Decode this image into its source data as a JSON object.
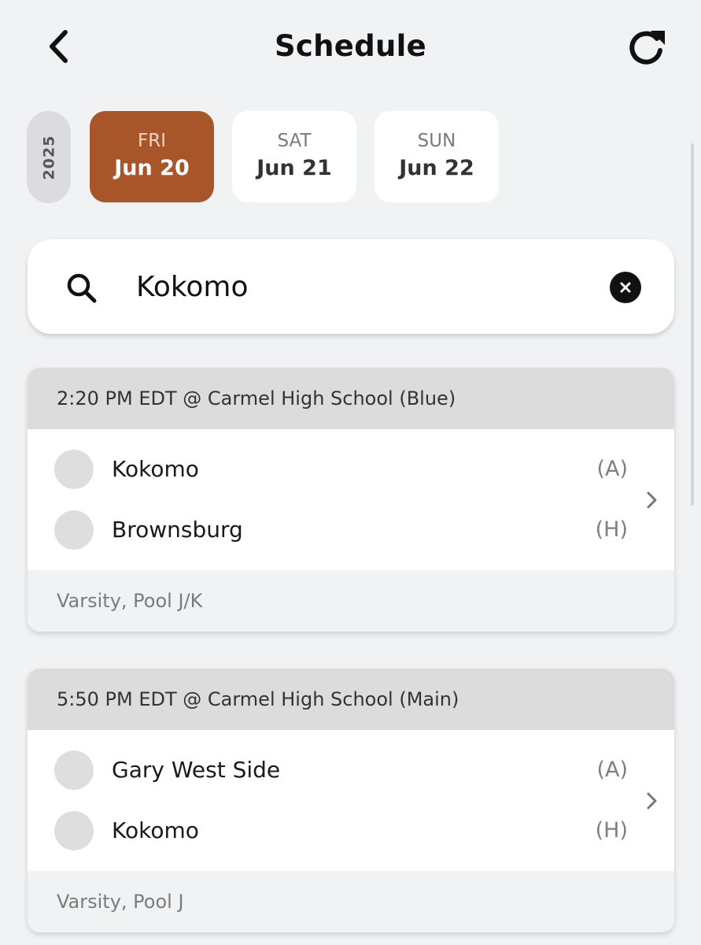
{
  "header": {
    "title": "Schedule",
    "back_icon": "chevron-left-icon",
    "refresh_icon": "refresh-icon"
  },
  "date_strip": {
    "year": "2025",
    "days": [
      {
        "dow": "FRI",
        "date": "Jun 20",
        "selected": true
      },
      {
        "dow": "SAT",
        "date": "Jun 21",
        "selected": false
      },
      {
        "dow": "SUN",
        "date": "Jun 22",
        "selected": false
      }
    ]
  },
  "search": {
    "value": "Kokomo",
    "icon": "search-icon",
    "clear_icon": "clear-icon"
  },
  "games": [
    {
      "header": "2:20 PM EDT @ Carmel High School (Blue)",
      "teams": [
        {
          "name": "Kokomo",
          "side": "(A)"
        },
        {
          "name": "Brownsburg",
          "side": "(H)"
        }
      ],
      "footer": "Varsity, Pool J/K"
    },
    {
      "header": "5:50 PM EDT @ Carmel High School (Main)",
      "teams": [
        {
          "name": "Gary West Side",
          "side": "(A)"
        },
        {
          "name": "Kokomo",
          "side": "(H)"
        }
      ],
      "footer": "Varsity, Pool J"
    }
  ],
  "colors": {
    "accent": "#a8552a",
    "background": "#f1f2f4",
    "card_header": "#dcdcdd"
  }
}
